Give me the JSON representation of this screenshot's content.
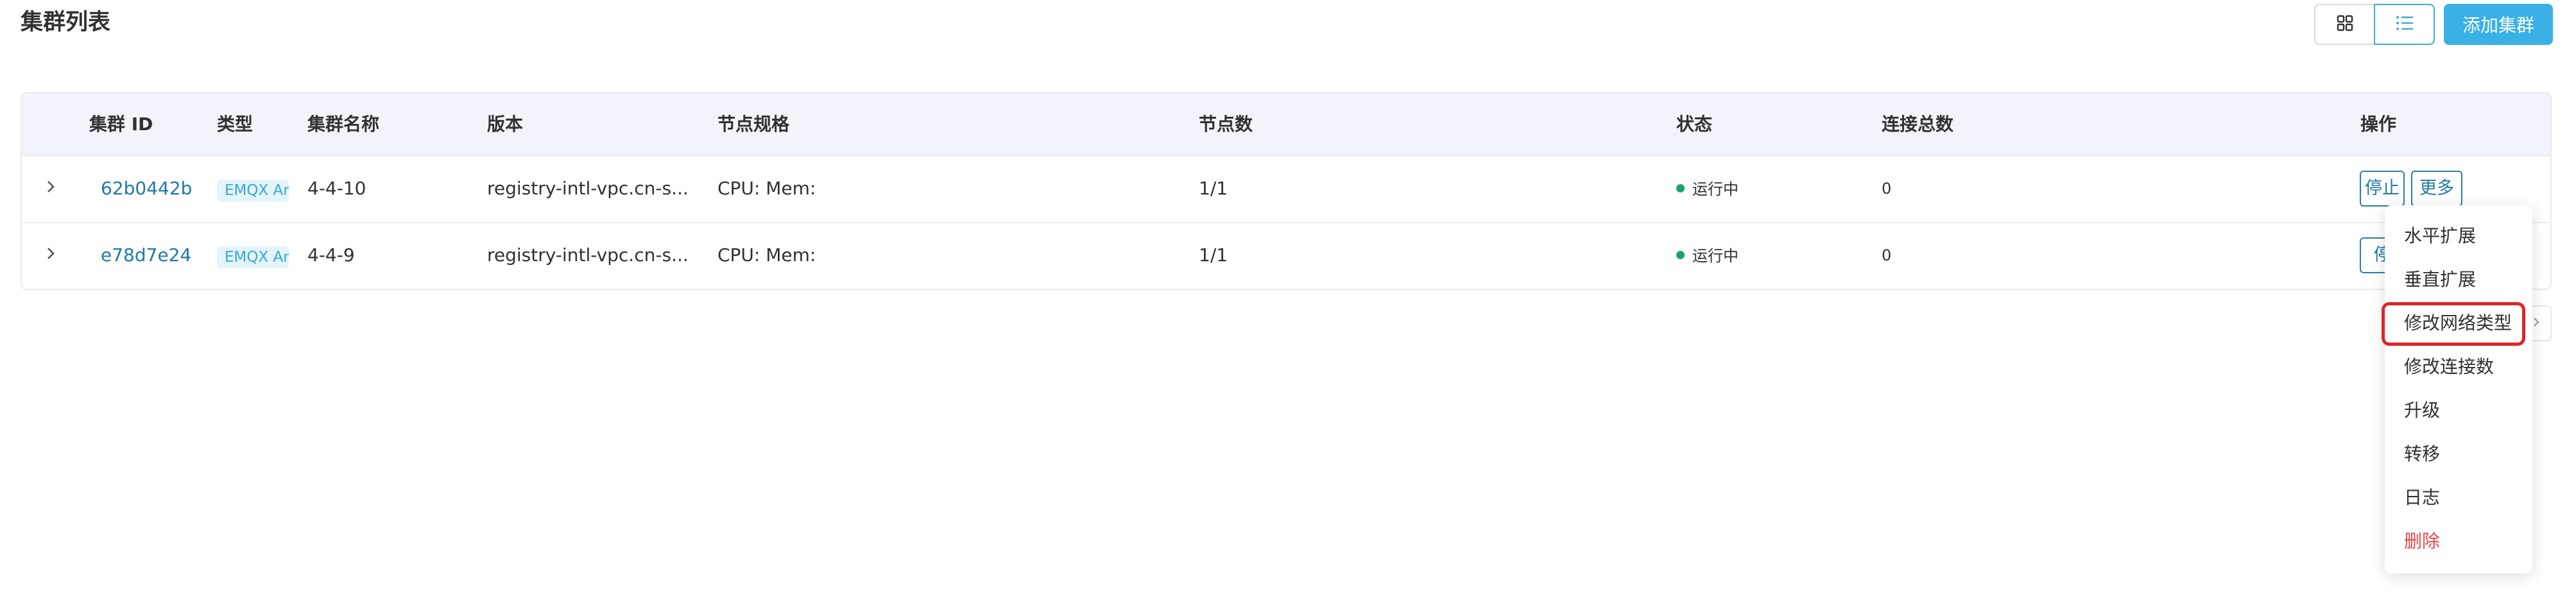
{
  "page": {
    "title": "集群列表"
  },
  "toolbar": {
    "grid_view_icon": "grid-icon",
    "list_view_icon": "list-icon",
    "add_label": "添加集群"
  },
  "table": {
    "columns": [
      "集群 ID",
      "类型",
      "集群名称",
      "版本",
      "节点规格",
      "节点数",
      "状态",
      "连接总数",
      "操作"
    ],
    "rows": [
      {
        "id": "62b0442b",
        "type": "EMQX Ar",
        "name": "4-4-10",
        "version": "registry-intl-vpc.cn-s...",
        "spec": "CPU: Mem:",
        "nodes": "1/1",
        "status": "运行中",
        "connections": "0",
        "stop_label": "停止",
        "more_label": "更多"
      },
      {
        "id": "e78d7e24",
        "type": "EMQX Ar",
        "name": "4-4-9",
        "version": "registry-intl-vpc.cn-s...",
        "spec": "CPU: Mem:",
        "nodes": "1/1",
        "status": "运行中",
        "connections": "0",
        "stop_label": "停"
      }
    ]
  },
  "dropdown": {
    "items": [
      "水平扩展",
      "垂直扩展",
      "修改网络类型",
      "修改连接数",
      "升级",
      "转移",
      "日志",
      "删除"
    ],
    "highlighted": "修改网络类型",
    "danger_item": "删除"
  },
  "colors": {
    "accent": "#39b1e6",
    "link": "#1f7aa6",
    "status_running": "#19a468",
    "danger": "#e5484d",
    "highlight": "#e02424",
    "header_bg": "#f3f4fb"
  }
}
